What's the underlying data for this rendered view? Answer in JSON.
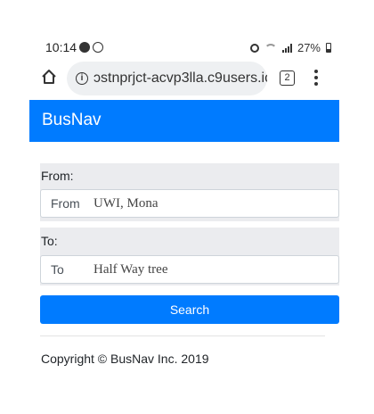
{
  "status_bar": {
    "time": "10:14",
    "battery": "27%"
  },
  "browser": {
    "url": "ɔstnprjct-acvp3lla.c9users.io",
    "tab_count": "2",
    "info_symbol": "i"
  },
  "navbar": {
    "brand": "BusNav",
    "color": "#007bff"
  },
  "form": {
    "from_label": "From:",
    "from_prefix": "From",
    "from_value": "UWI, Mona",
    "to_label": "To:",
    "to_prefix": "To",
    "to_value": "Half Way tree",
    "search_label": "Search"
  },
  "footer": {
    "copyright": "Copyright © BusNav Inc. 2019"
  }
}
